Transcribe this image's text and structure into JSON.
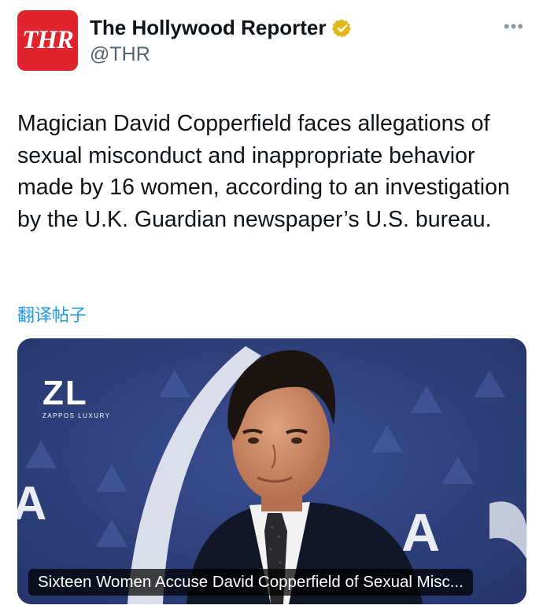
{
  "account": {
    "avatar_text": "THR",
    "display_name": "The Hollywood Reporter",
    "handle": "@THR",
    "verified_badge_icon": "gold-verified-badge-icon"
  },
  "more_button": {
    "icon": "more-dots-icon",
    "glyph": "•••"
  },
  "tweet": {
    "text": "Magician David Copperfield faces allegations of sexual misconduct and inappropriate behavior made by 16 women, according to an investigation by the U.K. Guardian newspaper’s U.S. bureau.",
    "translate_label": "翻译帖子"
  },
  "media": {
    "logo_mark": "ZL",
    "logo_subtext": "ZAPPOS LUXURY",
    "caption": "Sixteen Women Accuse David Copperfield of Sexual Misc..."
  },
  "colors": {
    "brand_red": "#e0232d",
    "link_blue": "#1d9bf0",
    "backdrop_blue": "#2e3f7a",
    "badge_gold": "#e2b719"
  }
}
